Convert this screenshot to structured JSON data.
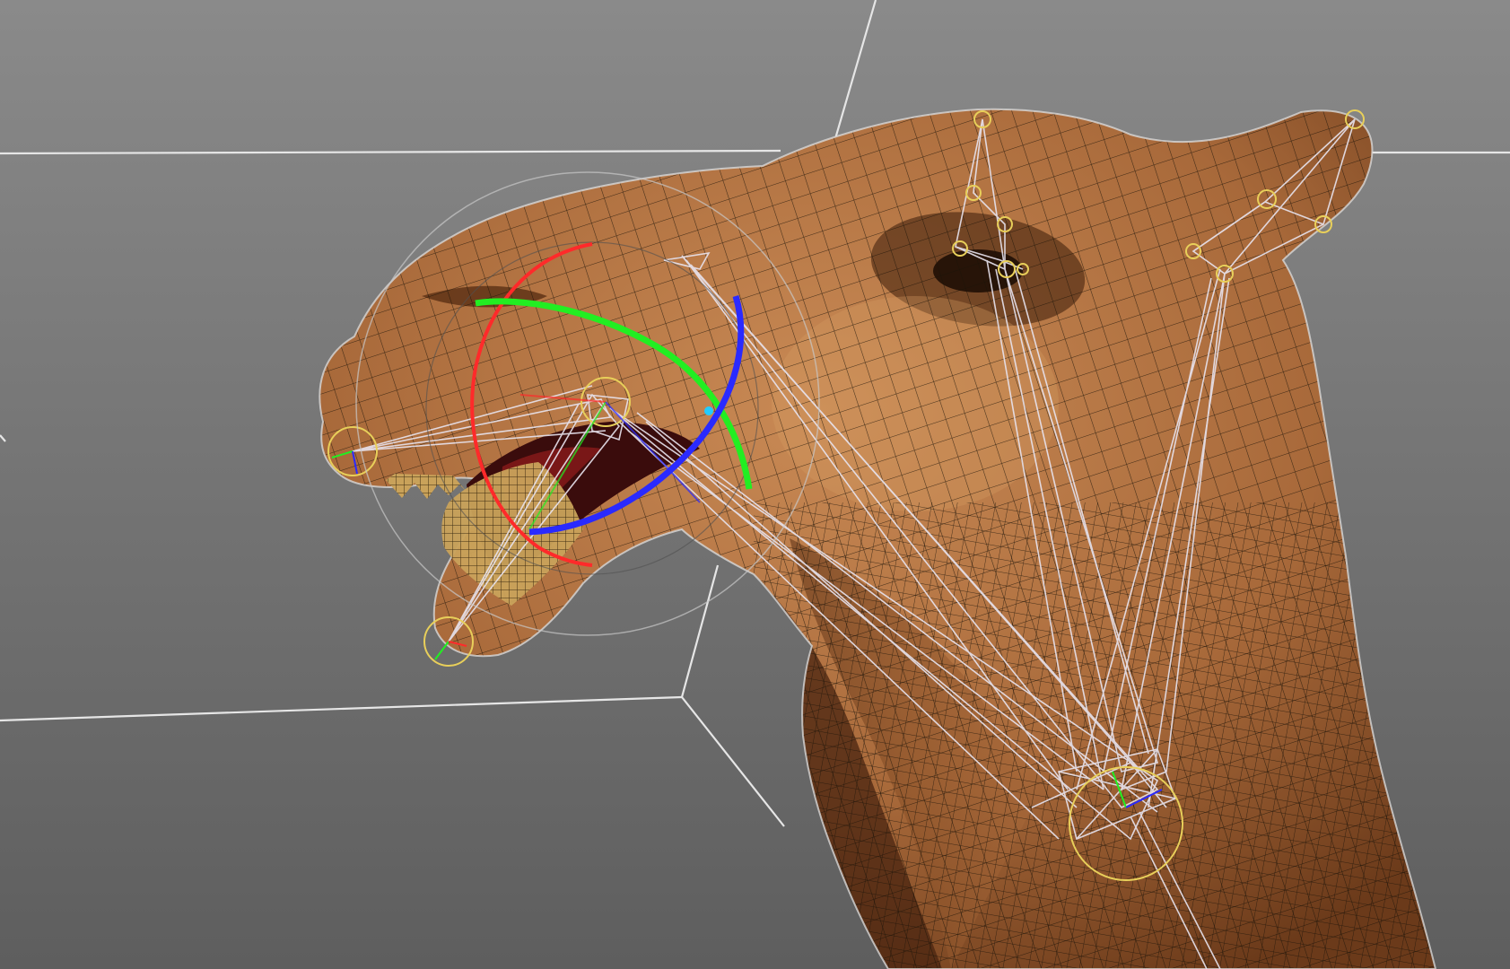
{
  "viewport": {
    "background_top": "#8a8a8a",
    "background_bottom": "#5e5e5e",
    "grid_line_color": "#e6e6e6",
    "skin_color": "#a8693a",
    "skin_shadow_color": "#5a2f14",
    "wire_color": "#1a1208",
    "bone_color": "#e8e4ef",
    "joint_color": "#e8cf5a",
    "gizmo": {
      "x_axis_color": "#ff2a2a",
      "y_axis_color": "#22ee22",
      "z_axis_color": "#2a2aff",
      "outer_ring_color": "#c8c8c8"
    },
    "icons": [
      "rotate-gizmo-icon",
      "joint-icon",
      "bone-icon"
    ]
  }
}
